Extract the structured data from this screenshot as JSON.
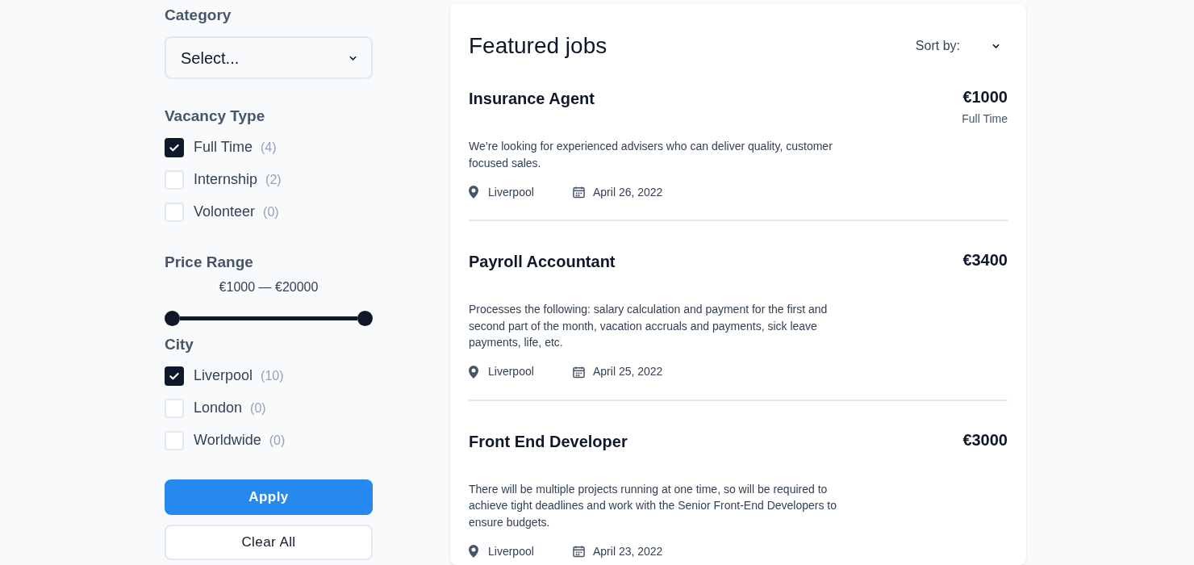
{
  "filters": {
    "category": {
      "label": "Category",
      "select": {
        "value": "Select..."
      }
    },
    "vacancy_type": {
      "label": "Vacancy Type",
      "options": [
        {
          "label": "Full Time",
          "count": "(4)",
          "checked": true
        },
        {
          "label": "Internship",
          "count": "(2)",
          "checked": false
        },
        {
          "label": "Volonteer",
          "count": "(0)",
          "checked": false
        }
      ]
    },
    "price_range": {
      "label": "Price Range",
      "reading": "€1000 — €20000",
      "thumbs": [
        {
          "level": 0
        },
        {
          "level": 1
        }
      ]
    },
    "city": {
      "label": "City",
      "options": [
        {
          "label": "Liverpool",
          "count": "(10)",
          "checked": true
        },
        {
          "label": "London",
          "count": "(0)",
          "checked": false
        },
        {
          "label": "Worldwide",
          "count": "(0)",
          "checked": false
        }
      ]
    },
    "buttons": [
      {
        "label": "Apply",
        "kind": "primary"
      },
      {
        "label": "Clear All",
        "kind": "secondary"
      }
    ]
  },
  "jobs_panel": {
    "title": "Featured jobs",
    "sort": {
      "label": "Sort by:"
    },
    "jobs": [
      {
        "title": "Insurance Agent",
        "price": "€1000",
        "type": "Full Time",
        "description": "We’re looking for experienced advisers who can deliver quality, customer focused sales.",
        "city": "Liverpool",
        "date": "April 26, 2022"
      },
      {
        "title": "Payroll Accountant",
        "price": "€3400",
        "description": "Processes the following: salary calculation and payment for the first and second part of the month, vacation accruals and payments, sick leave payments, life, etc.",
        "city": "Liverpool",
        "date": "April 25, 2022"
      },
      {
        "title": "Front End Developer",
        "price": "€3000",
        "description": "There will be multiple projects running at one time, so will be required to achieve tight deadlines and work with the Senior Front-End Developers to ensure budgets.",
        "city": "Liverpool",
        "date": "April 23, 2022"
      }
    ]
  }
}
